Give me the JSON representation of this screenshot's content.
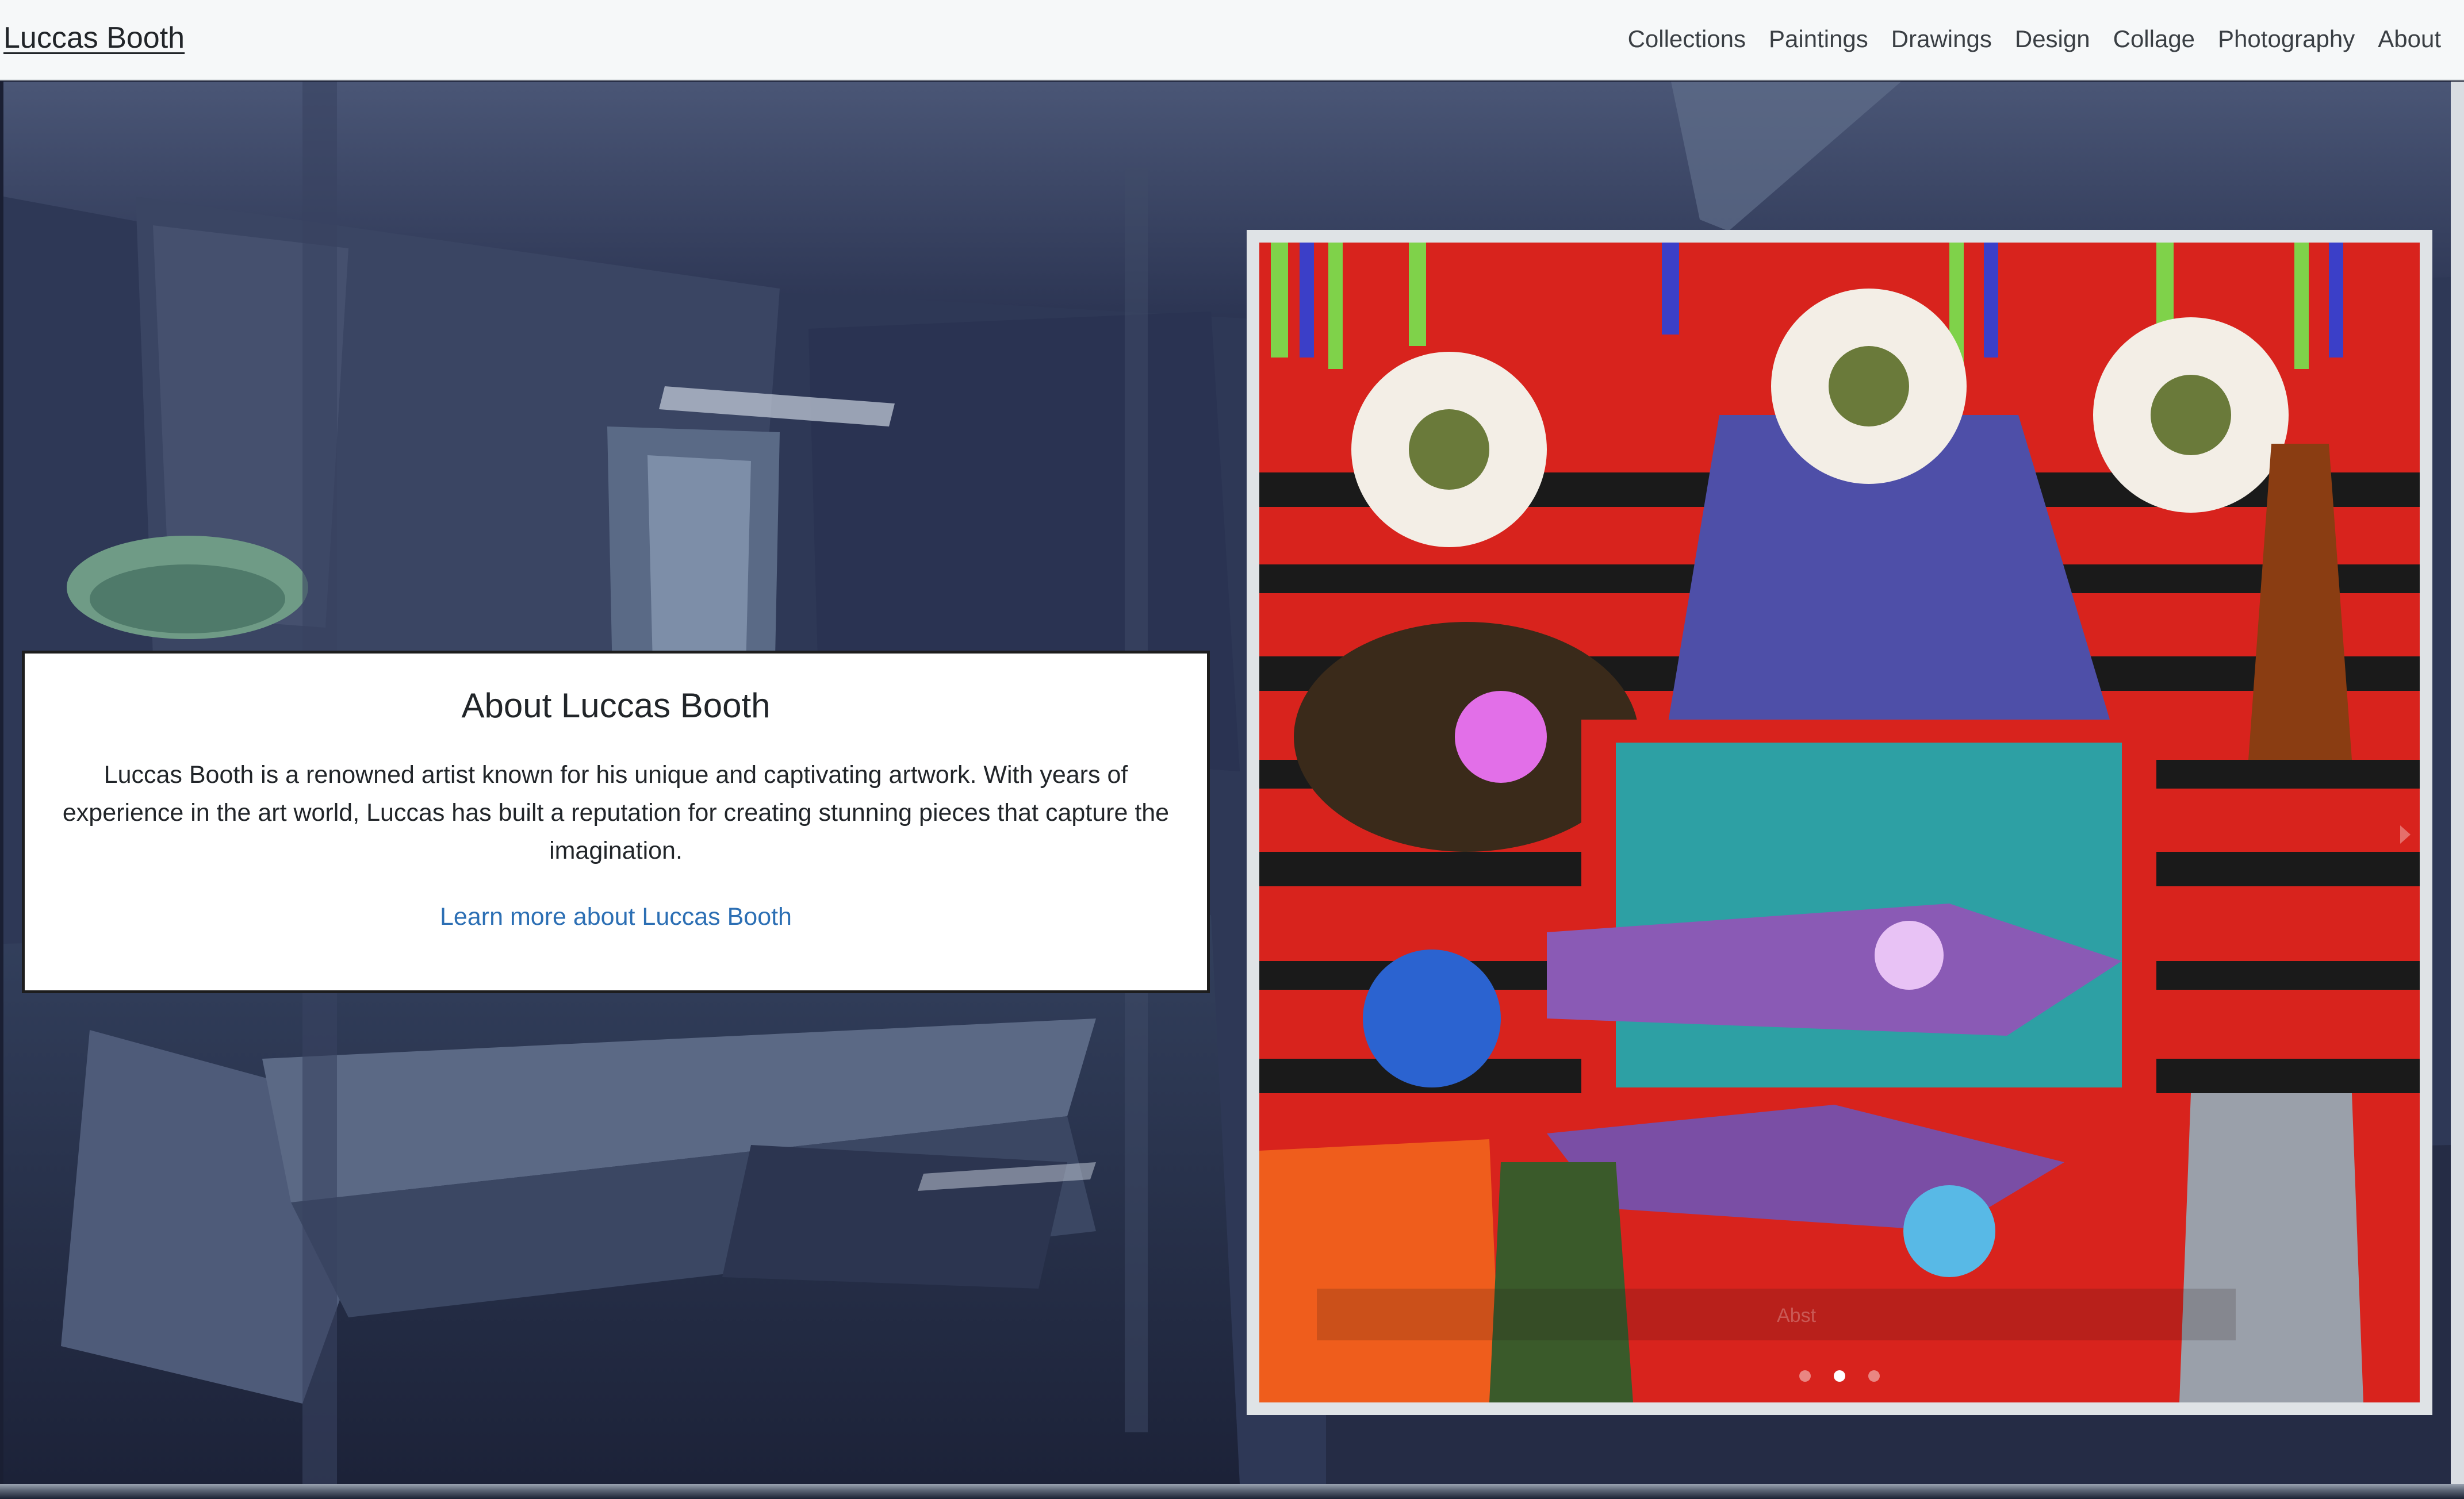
{
  "brand": "Luccas Booth",
  "nav": {
    "items": [
      "Collections",
      "Paintings",
      "Drawings",
      "Design",
      "Collage",
      "Photography",
      "About"
    ]
  },
  "about": {
    "title": "About Luccas Booth",
    "text": "Luccas Booth is a renowned artist known for his unique and captivating artwork. With years of experience in the art world, Luccas has built a reputation for creating stunning pieces that capture the imagination.",
    "link_label": "Learn more about Luccas Booth"
  },
  "carousel": {
    "slide_count": 3,
    "active_index": 1,
    "caption": "Abst"
  },
  "colors": {
    "navbar_bg": "#f6f8f9",
    "link": "#2c6fb4",
    "hero_tone": "#2b3552"
  },
  "icons": {
    "next": "chevron-right-icon"
  }
}
